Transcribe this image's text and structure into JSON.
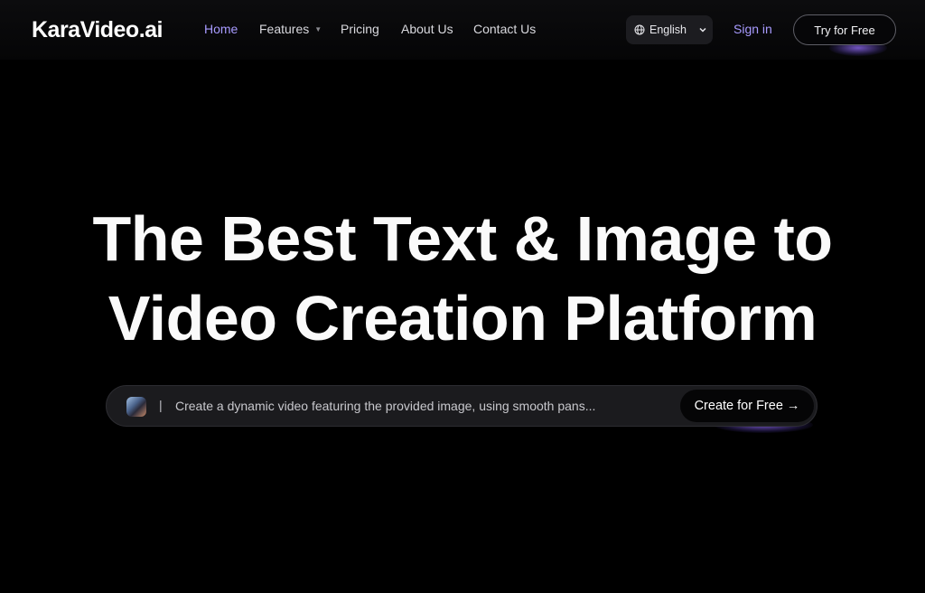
{
  "header": {
    "logo": "KaraVideo.ai",
    "nav": [
      {
        "label": "Home",
        "active": true
      },
      {
        "label": "Features",
        "has_dropdown": true
      },
      {
        "label": "Pricing"
      },
      {
        "label": "About Us"
      },
      {
        "label": "Contact Us"
      }
    ],
    "language": {
      "selected": "English",
      "icon": "globe-icon"
    },
    "sign_in": "Sign in",
    "try_button": "Try for Free"
  },
  "hero": {
    "line1": "The Best Text & Image to",
    "line2": "Video Creation Platform"
  },
  "prompt": {
    "separator": "|",
    "text": "Create a dynamic video featuring the provided image, using smooth pans...",
    "button": "Create for Free →"
  },
  "colors": {
    "background": "#000000",
    "accent": "#a89bff",
    "glow": "#8c6cff"
  }
}
